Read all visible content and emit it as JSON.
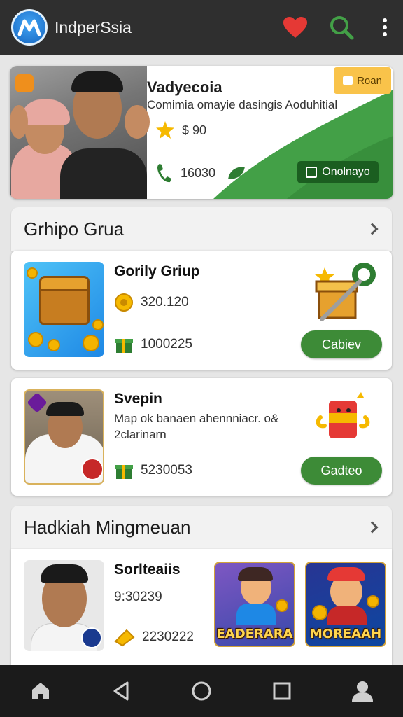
{
  "app": {
    "title": "IndperSsia",
    "icons": [
      "app-logo-icon",
      "heart-icon",
      "search-icon",
      "more-vert-icon"
    ],
    "accent": "#2f2f2f"
  },
  "promo": {
    "title": "Vadyecoia",
    "subtitle": "Comimia omayie dasingis Aoduhitial",
    "coins": "$ 90",
    "calls": "16030",
    "roam_label": "Roan",
    "online_label": "Onolnayo",
    "colors": {
      "green": "#43a047",
      "gold": "#f9c34a"
    }
  },
  "section1": {
    "title": "Grhipo Grua"
  },
  "card1": {
    "title": "Gorily Griup",
    "stat1": "320.120",
    "stat2": "1000225",
    "button": "Cabiev"
  },
  "card2": {
    "title": "Svepin",
    "desc": "Map ok banaen ahennniacr. o& 2clarinarn",
    "stat": "5230053",
    "button": "Gadteo"
  },
  "section2": {
    "title": "Hadkiah Mingmeuan"
  },
  "card3": {
    "title": "Sorlteaiis",
    "time": "9:30239",
    "stat": "2230222",
    "game1": "EADERARA",
    "game2": "MOREAAH"
  },
  "nav": {
    "items": [
      "home-icon",
      "back-icon",
      "home-circle-icon",
      "recents-icon",
      "profile-icon"
    ]
  }
}
